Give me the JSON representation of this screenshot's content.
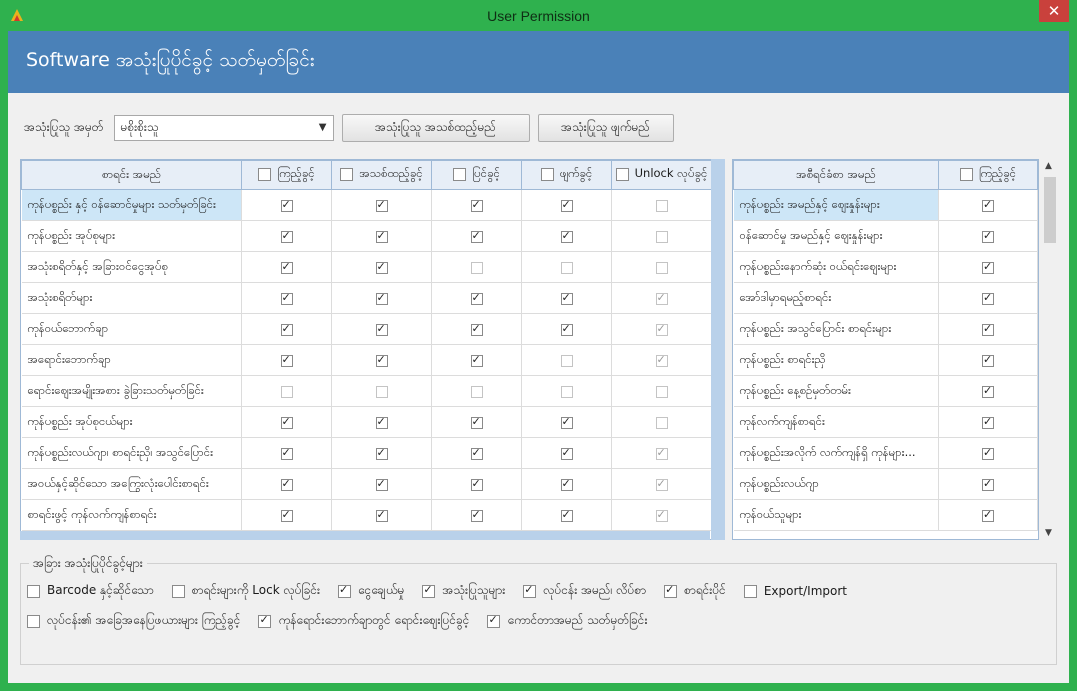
{
  "window": {
    "title": "User Permission",
    "close_glyph": "✕"
  },
  "banner": {
    "title": "Software အသုံးပြုပိုင်ခွင့် သတ်မှတ်ခြင်း"
  },
  "user_select": {
    "label": "အသုံးပြုသူ အမှတ်",
    "value": "မစိုးစိုးသူ",
    "add_button": "အသုံးပြုသူ အသစ်ထည့်မည်",
    "delete_button": "အသုံးပြုသူ ဖျက်မည်"
  },
  "left_grid": {
    "columns": [
      "စာရင်း အမည်",
      "ကြည့်ခွင့်",
      "အသစ်ထည့်ခွင့်",
      "ပြင်ခွင့်",
      "ဖျက်ခွင့်",
      "Unlock လုပ်ခွင့်"
    ],
    "rows": [
      {
        "name": "ကုန်ပစ္စည်း နှင့် ဝန်ဆောင်မှုများ သတ်မှတ်ခြင်း",
        "checks": [
          true,
          true,
          true,
          true,
          false
        ],
        "selected": true
      },
      {
        "name": "ကုန်ပစ္စည်း အုပ်စုများ",
        "checks": [
          true,
          true,
          true,
          true,
          false
        ]
      },
      {
        "name": "အသုံးစရိတ်နှင့် အခြားဝင်ငွေအုပ်စု",
        "checks": [
          true,
          true,
          false,
          false,
          false
        ]
      },
      {
        "name": "အသုံးစရိတ်များ",
        "checks": [
          true,
          true,
          true,
          true,
          true
        ]
      },
      {
        "name": "ကုန်ဝယ်ဘောက်ချာ",
        "checks": [
          true,
          true,
          true,
          true,
          true
        ]
      },
      {
        "name": "အရောင်းဘောက်ချာ",
        "checks": [
          true,
          true,
          true,
          false,
          true
        ]
      },
      {
        "name": "ရောင်းဈေးအမျိုးအစား ခွဲခြားသတ်မှတ်ခြင်း",
        "checks": [
          false,
          false,
          false,
          false,
          false
        ]
      },
      {
        "name": "ကုန်ပစ္စည်း အုပ်စုငယ်များ",
        "checks": [
          true,
          true,
          true,
          true,
          false
        ]
      },
      {
        "name": "ကုန်ပစ္စည်းလယ်ဂျာ၊ စာရင်းညှိ၊ အသွင်ပြောင်း",
        "checks": [
          true,
          true,
          true,
          true,
          true
        ]
      },
      {
        "name": "အဝယ်နှင့်ဆိုင်သော အကြွေးလုံးပေါင်းစာရင်း",
        "checks": [
          true,
          true,
          true,
          true,
          true
        ]
      },
      {
        "name": "စာရင်းဖွင့် ကုန်လက်ကျန်စာရင်း",
        "checks": [
          true,
          true,
          true,
          true,
          true
        ]
      }
    ]
  },
  "right_grid": {
    "columns": [
      "အစီရင်ခံစာ အမည်",
      "ကြည့်ခွင့်"
    ],
    "rows": [
      {
        "name": "ကုန်ပစ္စည်း အမည်နှင့် ဈေးနှုန်းများ",
        "checked": true,
        "selected": true
      },
      {
        "name": "ဝန်ဆောင်မှု အမည်နှင့် ဈေးနှုန်းများ",
        "checked": true
      },
      {
        "name": "ကုန်ပစ္စည်းနောက်ဆုံး ဝယ်ရင်းဈေးများ",
        "checked": true
      },
      {
        "name": "အော်ဒါမှာရမည့်စာရင်း",
        "checked": true
      },
      {
        "name": "ကုန်ပစ္စည်း အသွင်ပြောင်း စာရင်းများ",
        "checked": true
      },
      {
        "name": "ကုန်ပစ္စည်း စာရင်းညှိ",
        "checked": true
      },
      {
        "name": "ကုန်ပစ္စည်း နေ့စဉ်မှတ်တမ်း",
        "checked": true
      },
      {
        "name": "ကုန်လက်ကျန်စာရင်း",
        "checked": true
      },
      {
        "name": "ကုန်ပစ္စည်းအလိုက် လက်ကျန်ရှိ ကုန်များ...",
        "checked": true
      },
      {
        "name": "ကုန်ပစ္စည်းလယ်ဂျာ",
        "checked": true
      },
      {
        "name": "ကုန်ဝယ်သူများ",
        "checked": true
      }
    ]
  },
  "other_permissions": {
    "legend": "အခြား အသုံးပြုပိုင်ခွင့်များ",
    "row1": [
      {
        "label": "Barcode နှင့်ဆိုင်သော",
        "checked": false
      },
      {
        "label": "စာရင်းများကို Lock လုပ်ခြင်း",
        "checked": false
      },
      {
        "label": "ငွေချေယ်မှု",
        "checked": true
      },
      {
        "label": "အသုံးပြုသူများ",
        "checked": true
      },
      {
        "label": "လုပ်ငန်း အမည်၊ လိပ်စာ",
        "checked": true
      },
      {
        "label": "စာရင်းပိုင်",
        "checked": true
      },
      {
        "label": "Export/Import",
        "checked": false
      }
    ],
    "row2": [
      {
        "label": "လုပ်ငန်း၏ အခြေအနေပြဖယားများ ကြည့်ခွင့်",
        "checked": false
      },
      {
        "label": "ကုန်ရောင်းဘောက်ချာတွင် ရောင်းဈေးပြင်ခွင့်",
        "checked": true
      },
      {
        "label": "ကောင်တာအမည် သတ်မှတ်ခြင်း",
        "checked": true
      }
    ]
  },
  "colors": {
    "frame": "#2fb14e",
    "banner": "#4a81b8",
    "selection": "#cde6f7",
    "header": "#e7eef7",
    "close": "#c9413c"
  }
}
